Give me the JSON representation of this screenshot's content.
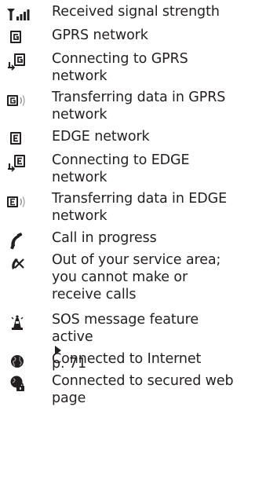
{
  "items": [
    {
      "icon": "signal-strength-icon",
      "lines": [
        "Received signal strength"
      ]
    },
    {
      "icon": "gprs-network-icon",
      "lines": [
        "GPRS network"
      ]
    },
    {
      "icon": "gprs-connecting-icon",
      "lines": [
        "Connecting to GPRS",
        "network"
      ]
    },
    {
      "icon": "gprs-transfer-icon",
      "lines": [
        "Transferring data in GPRS",
        "network"
      ]
    },
    {
      "icon": "edge-network-icon",
      "lines": [
        "EDGE network"
      ]
    },
    {
      "icon": "edge-connecting-icon",
      "lines": [
        "Connecting to EDGE",
        "network"
      ]
    },
    {
      "icon": "edge-transfer-icon",
      "lines": [
        "Transferring data in EDGE",
        "network"
      ]
    },
    {
      "icon": "call-in-progress-icon",
      "lines": [
        "Call in progress"
      ]
    },
    {
      "icon": "no-service-icon",
      "lines": [
        "Out of your service area;",
        "you cannot make or",
        "receive calls"
      ]
    },
    {
      "icon": "sos-active-icon",
      "lines": [
        "SOS message feature"
      ],
      "ref": {
        "prefix": "active",
        "page": "p. 71"
      }
    },
    {
      "icon": "internet-connected-icon",
      "lines": [
        "Connected to Internet"
      ]
    },
    {
      "icon": "secured-web-icon",
      "lines": [
        "Connected to secured web",
        "page"
      ]
    }
  ]
}
